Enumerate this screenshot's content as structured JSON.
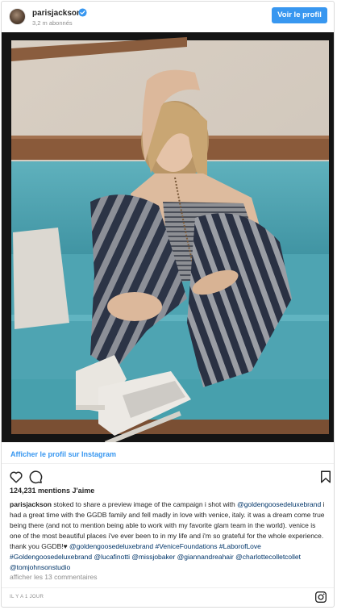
{
  "header": {
    "username": "parisjackson",
    "followers": "3,2 m abonnés",
    "follow_button": "Voir le profil",
    "avatar_icon": "avatar-image",
    "verified_icon": "verified-badge-icon"
  },
  "photo": {
    "description_icon": "post-photo"
  },
  "view_profile_link": "Afficher le profil sur Instagram",
  "actions": {
    "like_icon": "heart-icon",
    "comment_icon": "comment-icon",
    "save_icon": "bookmark-icon"
  },
  "likes": "124,231 mentions J'aime",
  "caption": {
    "username": "parisjackson",
    "text_1": " stoked to share a preview image of the campaign i shot with ",
    "mention_1": "@goldengoosedeluxebrand",
    "text_2": " i had a great time with the GGDB family and fell madly in love with venice, italy. it was a dream come true being there (and not to mention being able to work with my favorite glam team in the world). venice is one of the most beautiful places i've ever been to in my life and i'm so grateful for the whole experience. thank you GGDB!♥ ",
    "tags": "@goldengoosedeluxebrand #VeniceFoundations #LaborofLove #Goldengoosedeluxebrand @lucafinotti @missjobaker @giannandreahair @charlottecolletcollet @tomjohnsonstudio"
  },
  "comments_link": "afficher les 13 commentaires",
  "timestamp": "IL Y A 1 JOUR",
  "footer": {
    "instagram_icon": "instagram-glyph-icon"
  },
  "colors": {
    "accent": "#3897f0",
    "mention": "#003569",
    "muted": "#8e8e8e",
    "text": "#262626",
    "border": "#dbdbdb"
  }
}
